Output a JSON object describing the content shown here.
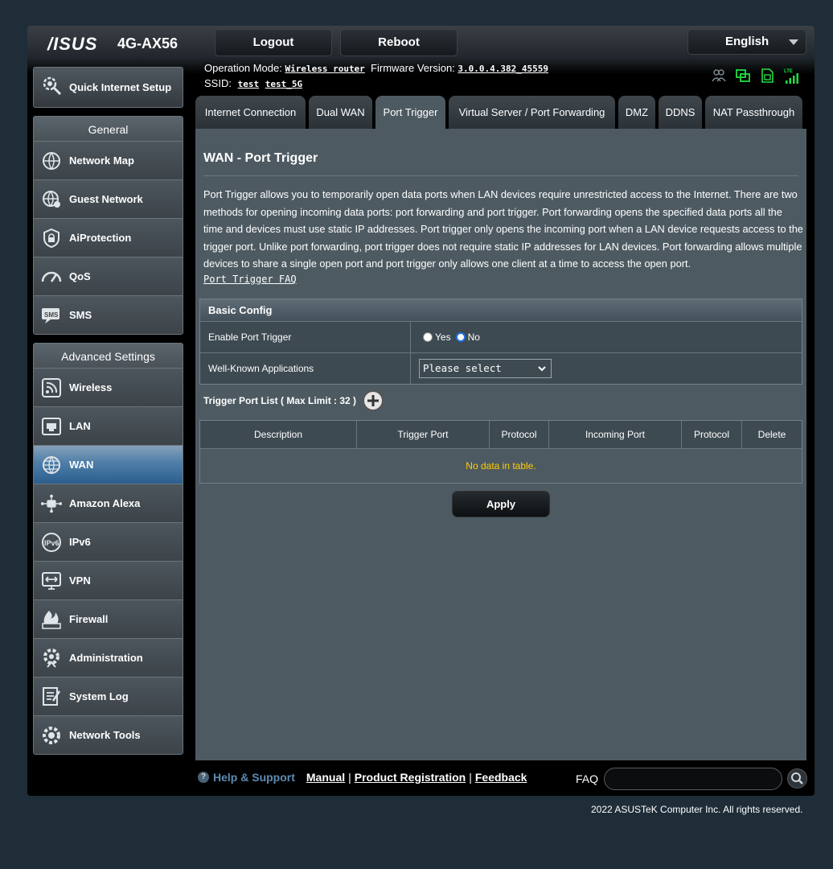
{
  "header": {
    "brand": "/ISUS",
    "model": "4G-AX56",
    "logout_label": "Logout",
    "reboot_label": "Reboot",
    "language": "English",
    "operation_mode_label": "Operation Mode:",
    "operation_mode_value": "Wireless router",
    "firmware_label": "Firmware Version:",
    "firmware_value": "3.0.0.4.382_45559",
    "ssid_label": "SSID:",
    "ssid_1": "test",
    "ssid_2": "test_5G",
    "lte_label": "LTE",
    "status_icons": [
      "clients-icon",
      "network-icon",
      "sim-icon",
      "lte-signal-icon"
    ]
  },
  "sidebar": {
    "qis_label": "Quick Internet Setup",
    "general_title": "General",
    "general_items": [
      {
        "label": "Network Map",
        "icon": "network-map-icon"
      },
      {
        "label": "Guest Network",
        "icon": "guest-network-icon"
      },
      {
        "label": "AiProtection",
        "icon": "aiprotection-icon"
      },
      {
        "label": "QoS",
        "icon": "qos-icon"
      },
      {
        "label": "SMS",
        "icon": "sms-icon"
      }
    ],
    "advanced_title": "Advanced Settings",
    "advanced_items": [
      {
        "label": "Wireless",
        "icon": "wireless-icon"
      },
      {
        "label": "LAN",
        "icon": "lan-icon"
      },
      {
        "label": "WAN",
        "icon": "wan-icon",
        "active": true
      },
      {
        "label": "Amazon Alexa",
        "icon": "alexa-icon"
      },
      {
        "label": "IPv6",
        "icon": "ipv6-icon"
      },
      {
        "label": "VPN",
        "icon": "vpn-icon"
      },
      {
        "label": "Firewall",
        "icon": "firewall-icon"
      },
      {
        "label": "Administration",
        "icon": "administration-icon"
      },
      {
        "label": "System Log",
        "icon": "system-log-icon"
      },
      {
        "label": "Network Tools",
        "icon": "network-tools-icon"
      }
    ]
  },
  "tabs": [
    {
      "label": "Internet Connection"
    },
    {
      "label": "Dual WAN"
    },
    {
      "label": "Port Trigger",
      "active": true
    },
    {
      "label": "Virtual Server / Port Forwarding"
    },
    {
      "label": "DMZ"
    },
    {
      "label": "DDNS"
    },
    {
      "label": "NAT Passthrough"
    }
  ],
  "main": {
    "title": "WAN - Port Trigger",
    "description": "Port Trigger allows you to temporarily open data ports when LAN devices require unrestricted access to the Internet. There are two methods for opening incoming data ports: port forwarding and port trigger. Port forwarding opens the specified data ports all the time and devices must use static IP addresses. Port trigger only opens the incoming port when a LAN device requests access to the trigger port. Unlike port forwarding, port trigger does not require static IP addresses for LAN devices. Port forwarding allows multiple devices to share a single open port and port trigger only allows one client at a time to access the open port.",
    "faq_link": "Port Trigger FAQ",
    "basic_config_title": "Basic Config",
    "enable_label": "Enable Port Trigger",
    "yes_label": "Yes",
    "no_label": "No",
    "enable_value": "No",
    "well_known_label": "Well-Known Applications",
    "well_known_value": "Please select",
    "trigger_list_label": "Trigger Port List ( Max Limit : 32 )",
    "table_headers": [
      "Description",
      "Trigger Port",
      "Protocol",
      "Incoming Port",
      "Protocol",
      "Delete"
    ],
    "empty_text": "No data in table.",
    "apply_label": "Apply"
  },
  "footer": {
    "help_support": "Help & Support",
    "manual": "Manual",
    "product_registration": "Product Registration",
    "feedback": "Feedback",
    "faq_label": "FAQ",
    "faq_placeholder": "",
    "copyright": "2022 ASUSTeK Computer Inc. All rights reserved."
  }
}
